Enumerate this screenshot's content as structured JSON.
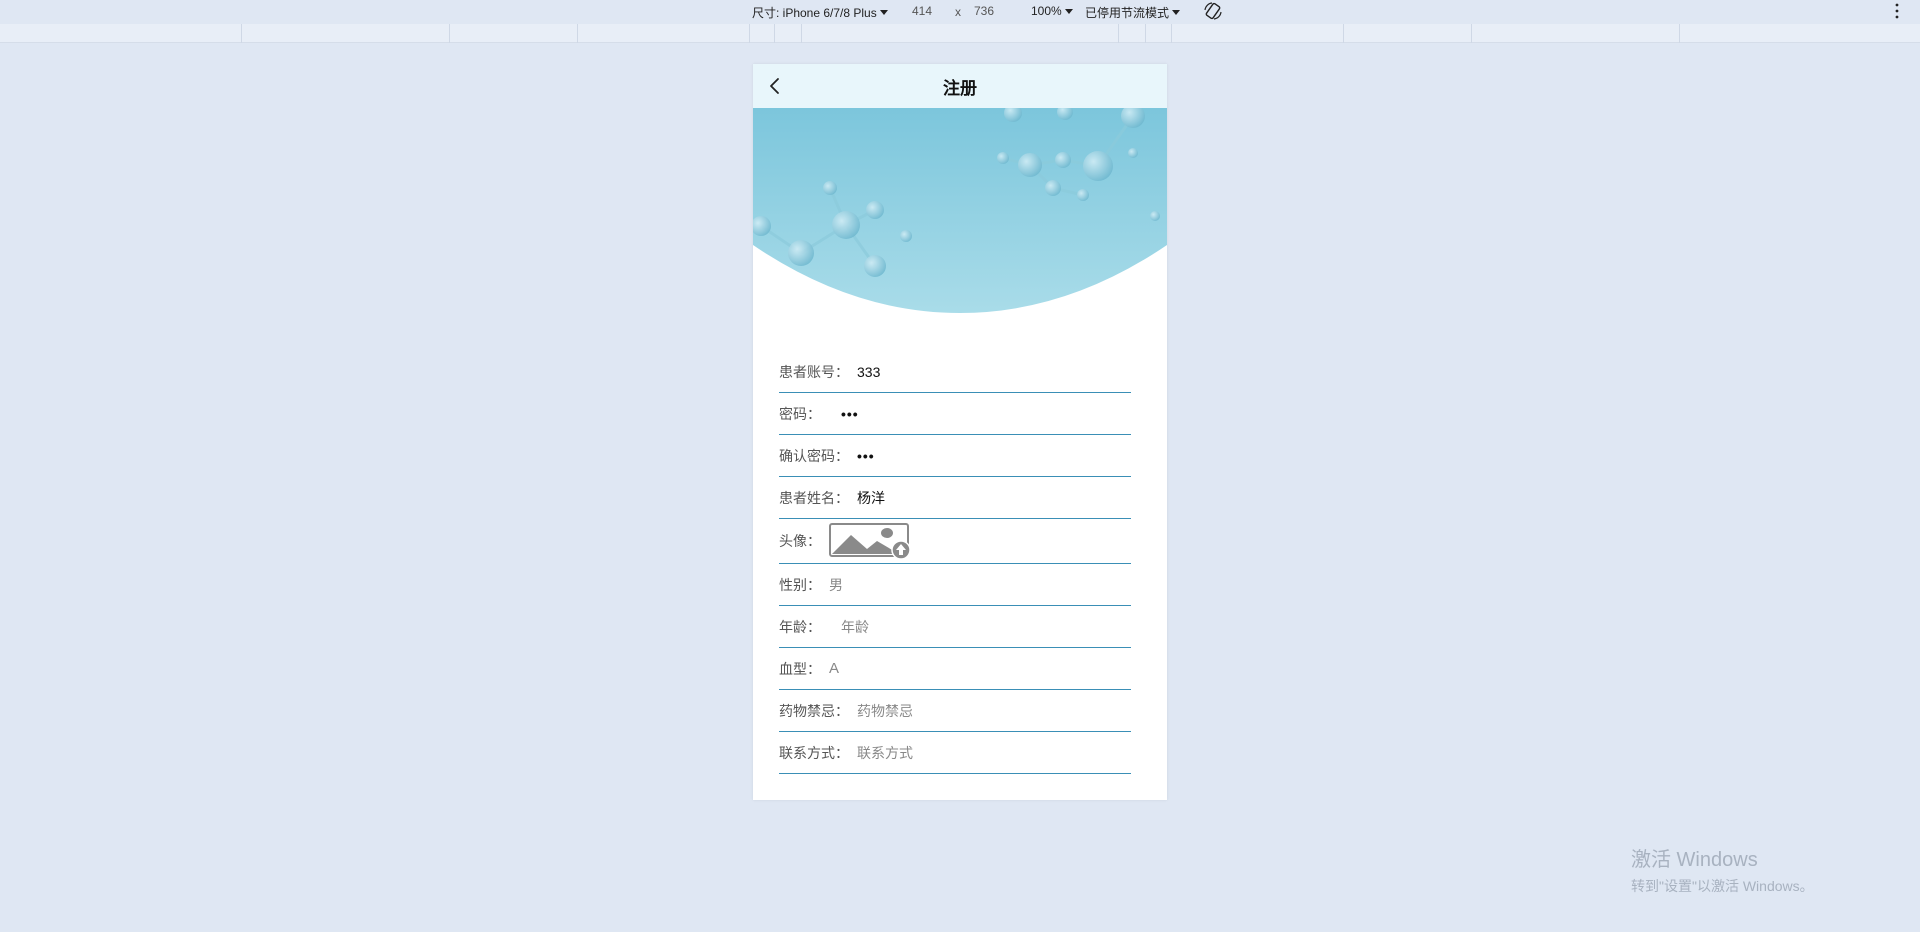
{
  "devtools": {
    "device_label": "尺寸: iPhone 6/7/8 Plus",
    "width": "414",
    "times": "x",
    "height": "736",
    "zoom": "100%",
    "throttle": "已停用节流模式"
  },
  "app": {
    "title": "注册",
    "fields": {
      "account": {
        "label": "患者账号：",
        "value": "333"
      },
      "password": {
        "label": "密码：",
        "value": "•••"
      },
      "confirm": {
        "label": "确认密码：",
        "value": "•••"
      },
      "name": {
        "label": "患者姓名：",
        "value": "杨洋"
      },
      "avatar": {
        "label": "头像："
      },
      "gender": {
        "label": "性别：",
        "value": "男"
      },
      "age": {
        "label": "年龄：",
        "placeholder": "年龄"
      },
      "blood": {
        "label": "血型：",
        "value": "A"
      },
      "allergy": {
        "label": "药物禁忌：",
        "placeholder": "药物禁忌"
      },
      "contact": {
        "label": "联系方式：",
        "placeholder": "联系方式"
      }
    }
  },
  "watermark": {
    "line1": "激活 Windows",
    "line2": "转到\"设置\"以激活 Windows。"
  },
  "colors": {
    "accent": "#3a8fb6",
    "page_bg": "#dfe7f3",
    "navbar_bg": "#e8f6fb"
  }
}
